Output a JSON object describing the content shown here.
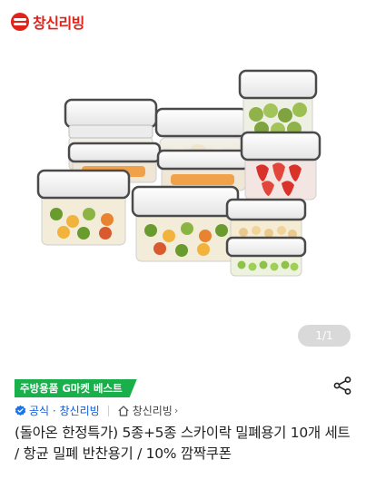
{
  "brand": {
    "name": "창신리빙",
    "logo_icon": "changsin-logo-icon",
    "color": "#e2231a"
  },
  "image_gallery": {
    "counter": "1/1"
  },
  "badge": {
    "label": "주방용품 G마켓 베스트",
    "color": "#19b04b"
  },
  "seller": {
    "official_label": "공식 · 창신리빙",
    "store_label": "창신리빙"
  },
  "product": {
    "title": "(돌아온 한정특가) 5종+5종 스카이락 밀폐용기 10개 세트 / 항균 밀폐 반찬용기 / 10% 깜짝쿠폰"
  },
  "colors": {
    "link": "#0f5ad8",
    "text": "#222222"
  }
}
